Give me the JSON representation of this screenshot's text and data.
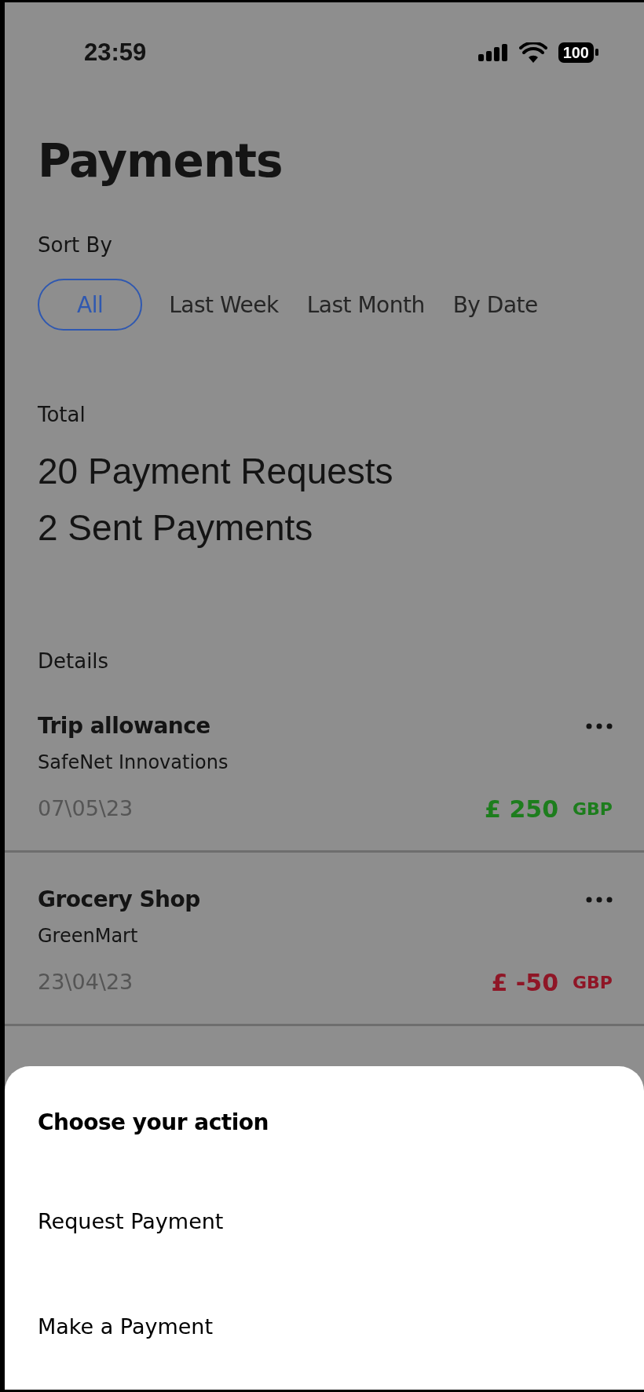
{
  "status_bar": {
    "time": "23:59",
    "battery": "100"
  },
  "title": "Payments",
  "sort": {
    "label": "Sort By",
    "options": [
      {
        "label": "All",
        "selected": true
      },
      {
        "label": "Last Week",
        "selected": false
      },
      {
        "label": "Last Month",
        "selected": false
      },
      {
        "label": "By Date",
        "selected": false
      }
    ]
  },
  "total": {
    "label": "Total",
    "lines": [
      "20 Payment Requests",
      "2 Sent Payments"
    ]
  },
  "details": {
    "label": "Details",
    "items": [
      {
        "title": "Trip allowance",
        "payee": "SafeNet Innovations",
        "date": "07\\05\\23",
        "amount": "£ 250",
        "currency": "GBP",
        "color": "#1d7d1d"
      },
      {
        "title": "Grocery Shop",
        "payee": "GreenMart",
        "date": "23\\04\\23",
        "amount": "£ -50",
        "currency": "GBP",
        "color": "#8f1626"
      }
    ]
  },
  "sheet": {
    "title": "Choose your action",
    "actions": [
      "Request Payment",
      "Make a Payment"
    ]
  }
}
